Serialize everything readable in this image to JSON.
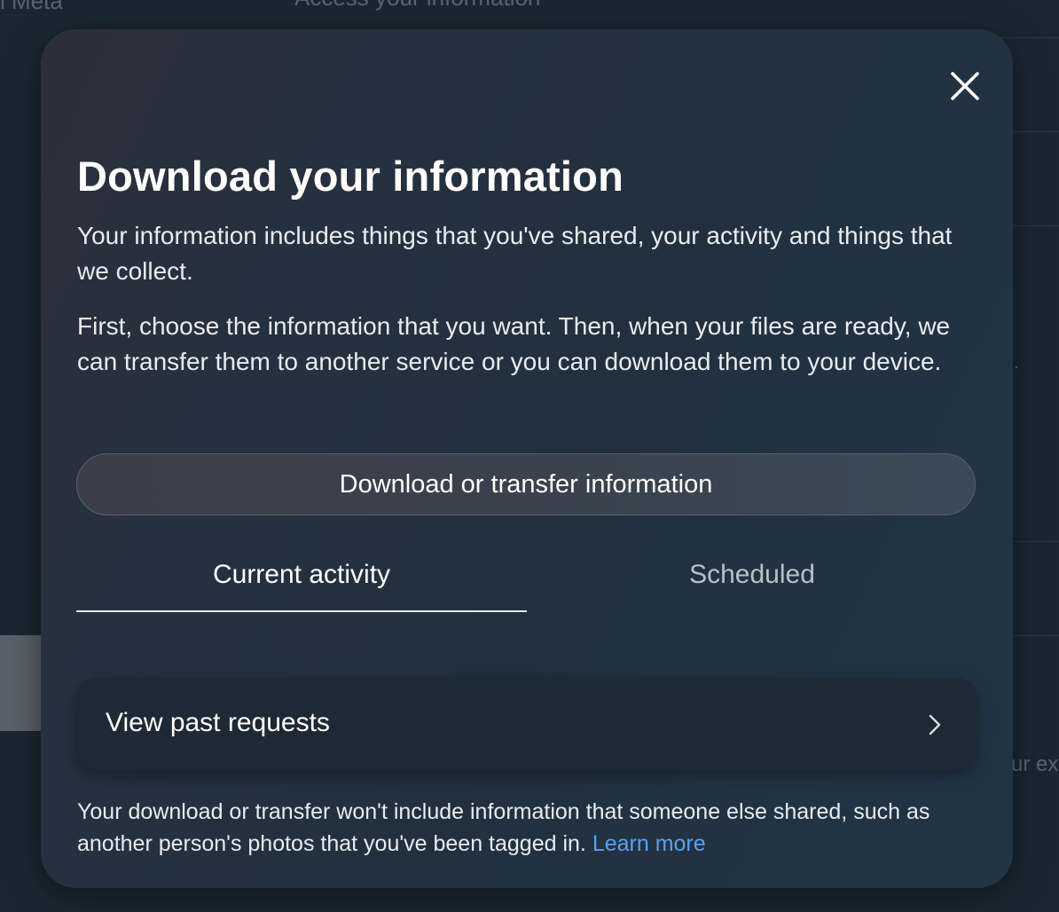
{
  "background": {
    "top_left_text": "l Meta",
    "top_center_text": "Access your information",
    "right_text": "ur ex",
    "right_dot": "."
  },
  "modal": {
    "title": "Download your information",
    "description_1": "Your information includes things that you've shared, your activity and things that we collect.",
    "description_2": "First, choose the information that you want. Then, when your files are ready, we can transfer them to another service or you can download them to your device.",
    "primary_button_label": "Download or transfer information",
    "tabs": [
      {
        "label": "Current activity",
        "selected": true
      },
      {
        "label": "Scheduled",
        "selected": false
      }
    ],
    "past_requests_label": "View past requests",
    "footer_text": "Your download or transfer won't include information that someone else shared, such as another person's photos that you've been tagged in. ",
    "footer_link": "Learn more"
  },
  "icons": {
    "close": "close-icon",
    "chevron": "chevron-right-icon"
  },
  "colors": {
    "link": "#5aa0f2",
    "text_primary": "#ffffff",
    "tab_inactive": "#b8c0c7"
  }
}
